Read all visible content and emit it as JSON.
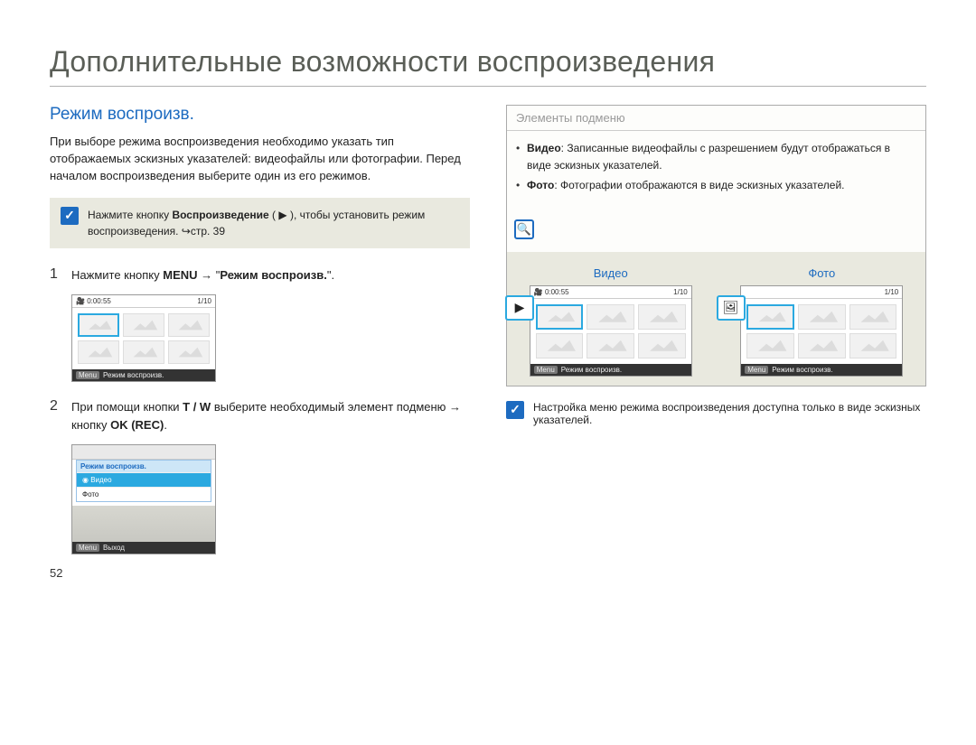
{
  "pageTitle": "Дополнительные возможности воспроизведения",
  "pageNumber": "52",
  "left": {
    "heading": "Режим воспроизв.",
    "intro": "При выборе режима воспроизведения необходимо указать тип отображаемых эскизных указателей: видеофайлы или фотографии. Перед началом воспроизведения выберите один из его режимов.",
    "note_pre": "Нажмите кнопку ",
    "note_bold": "Воспроизведение",
    "note_post": " ( ▶ ), чтобы установить режим воспроизведения. ↪стр. 39",
    "step1_num": "1",
    "step1_pre": "Нажмите кнопку ",
    "step1_b1": "MENU",
    "step1_arrow": " → \"",
    "step1_b2": "Режим воспроизв.",
    "step1_end": "\".",
    "step2_num": "2",
    "step2_pre": "При помощи кнопки ",
    "step2_b1": "T / W",
    "step2_mid": " выберите необходимый элемент подменю → кнопку ",
    "step2_b2": "OK (REC)",
    "step2_end": ".",
    "thumbScreen": {
      "time": "0:00:55",
      "counter": "1/10",
      "menuTag": "Menu",
      "footer": "Режим воспроизв."
    },
    "menuScreen": {
      "header": "Режим воспроизв.",
      "row1": "Видео",
      "row2": "Фото",
      "exitTag": "Menu",
      "exit": "Выход"
    }
  },
  "right": {
    "boxTitle": "Элементы подменю",
    "item1_b": "Видео",
    "item1_t": ": Записанные видеофайлы с разрешением будут отображаться в виде эскизных указателей.",
    "item2_b": "Фото",
    "item2_t": ": Фотографии отображаются в виде эскизных указателей.",
    "zoomChar": "🔍",
    "video": {
      "label": "Видео",
      "time": "0:00:55",
      "counter": "1/10",
      "footer": "Режим воспроизв.",
      "icon": "▶"
    },
    "photo": {
      "label": "Фото",
      "counter": "1/10",
      "footer": "Режим воспроизв.",
      "icon": "🖼"
    },
    "note2": "Настройка меню режима воспроизведения доступна только в виде эскизных указателей."
  }
}
